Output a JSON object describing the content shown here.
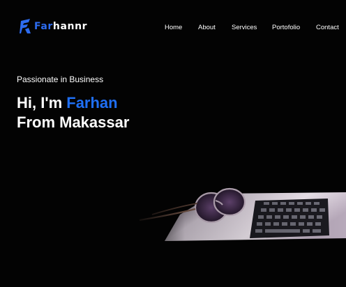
{
  "brand": {
    "logo_part1": "Far",
    "logo_part2": "hannr",
    "accent_color": "#1f6ff5"
  },
  "nav": {
    "items": [
      "Home",
      "About",
      "Services",
      "Portofolio",
      "Contact"
    ]
  },
  "hero": {
    "tagline": "Passionate in Business",
    "greeting": "Hi, I'm ",
    "name": "Farhan",
    "location": "From Makassar",
    "image_icon": "laptop-with-glasses-photo"
  }
}
